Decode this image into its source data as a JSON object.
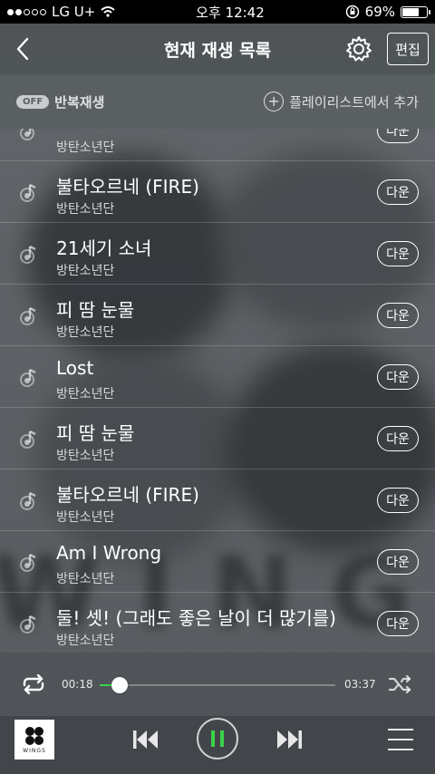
{
  "status": {
    "carrier": "LG U+",
    "time": "오후 12:42",
    "battery_percent": "69%",
    "battery_level": 0.69
  },
  "header": {
    "title": "현재 재생 목록",
    "edit_label": "편집"
  },
  "subbar": {
    "off_label": "OFF",
    "repeat_label": "반복재생",
    "add_label": "플레이리스트에서 추가"
  },
  "songs": [
    {
      "title": "",
      "artist": "방탄소년단",
      "down_label": "다운"
    },
    {
      "title": "불타오르네 (FIRE)",
      "artist": "방탄소년단",
      "down_label": "다운"
    },
    {
      "title": "21세기 소녀",
      "artist": "방탄소년단",
      "down_label": "다운"
    },
    {
      "title": "피 땀 눈물",
      "artist": "방탄소년단",
      "down_label": "다운"
    },
    {
      "title": "Lost",
      "artist": "방탄소년단",
      "down_label": "다운"
    },
    {
      "title": "피 땀 눈물",
      "artist": "방탄소년단",
      "down_label": "다운"
    },
    {
      "title": "불타오르네 (FIRE)",
      "artist": "방탄소년단",
      "down_label": "다운"
    },
    {
      "title": "Am I Wrong",
      "artist": "방탄소년단",
      "down_label": "다운"
    },
    {
      "title": "둘! 셋! (그래도 좋은 날이 더 많기를)",
      "artist": "방탄소년단",
      "down_label": "다운"
    }
  ],
  "progress": {
    "current": "00:18",
    "total": "03:37",
    "fraction": 0.083
  },
  "player": {
    "album_label": "WINGS"
  },
  "colors": {
    "accent": "#3cd24a"
  }
}
